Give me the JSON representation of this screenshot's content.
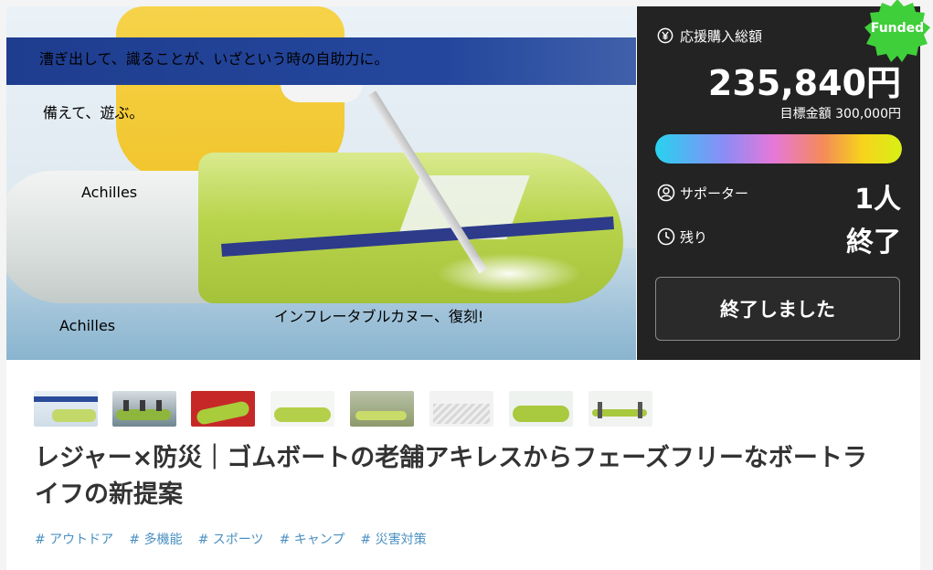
{
  "hero": {
    "banner_text": "漕ぎ出して、識ることが、いざという時の自助力に。",
    "headline": "備えて、遊ぶ。",
    "boat_logo": "Achilles",
    "brand": "Achilles",
    "tagline": "インフレータブルカヌー、復刻!"
  },
  "stats": {
    "funded_badge": "Funded",
    "total_label": "応援購入総額",
    "amount": "235,840円",
    "goal": "目標金額 300,000円",
    "progress_fraction": 1.0,
    "supporters_label": "サポーター",
    "supporters_value": "1人",
    "remaining_label": "残り",
    "remaining_value": "終了",
    "ended_button": "終了しました",
    "colors": {
      "panel_bg": "#232323",
      "badge": "#3fcf3a"
    }
  },
  "project": {
    "title": "レジャー×防災｜ゴムボートの老舗アキレスからフェーズフリーなボートライフの新提案",
    "tags": [
      "# アウトドア",
      "# 多機能",
      "# スポーツ",
      "# キャンプ",
      "# 災害対策"
    ]
  },
  "thumbnails": {
    "count": 8
  }
}
